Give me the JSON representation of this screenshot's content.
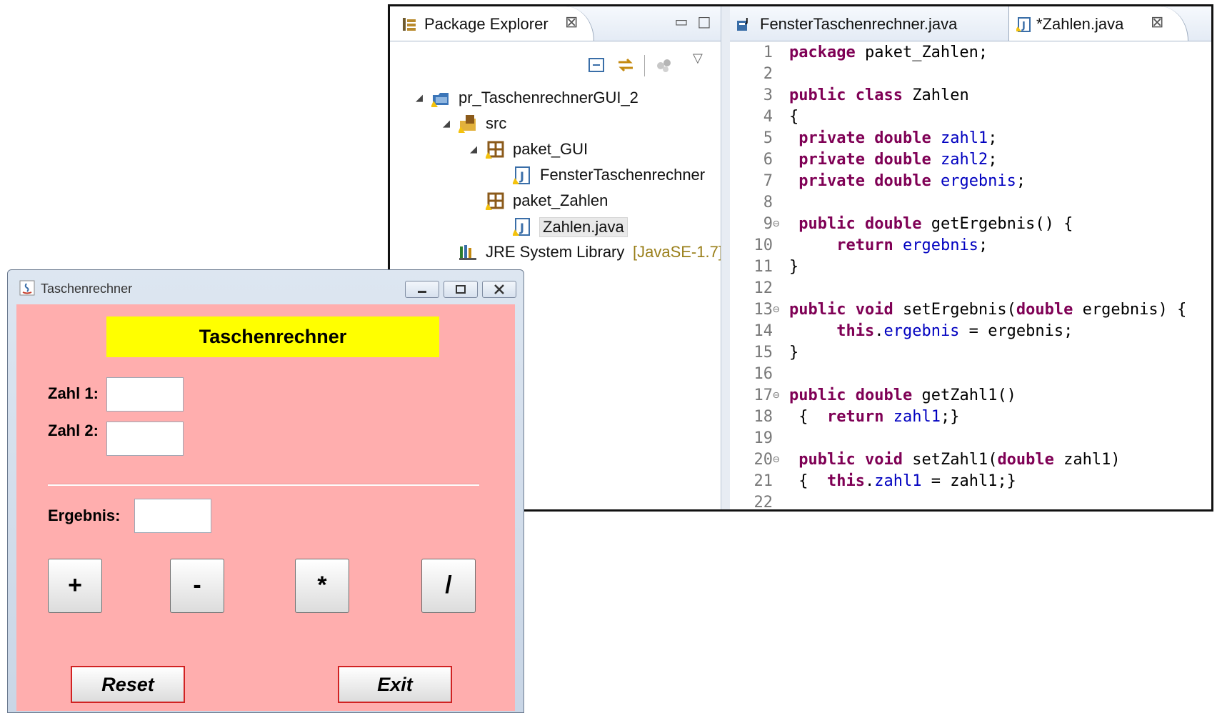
{
  "eclipse": {
    "package_explorer": {
      "tab_label": "Package Explorer",
      "tree": [
        {
          "label": "pr_TaschenrechnerGUI_2"
        },
        {
          "label": "src"
        },
        {
          "label": "paket_GUI"
        },
        {
          "label": "FensterTaschenrechner"
        },
        {
          "label": "paket_Zahlen"
        },
        {
          "label": "Zahlen.java"
        },
        {
          "label": "JRE System Library",
          "decoration": "[JavaSE-1.7]"
        }
      ]
    },
    "editor": {
      "tabs": [
        {
          "label": "FensterTaschenrechner.java"
        },
        {
          "label": "*Zahlen.java"
        }
      ],
      "lines": [
        {
          "n": "1",
          "code": "package paket_Zahlen;"
        },
        {
          "n": "2",
          "code": ""
        },
        {
          "n": "3",
          "code": "public class Zahlen"
        },
        {
          "n": "4",
          "code": "{"
        },
        {
          "n": "5",
          "code": " private double zahl1;"
        },
        {
          "n": "6",
          "code": " private double zahl2;"
        },
        {
          "n": "7",
          "code": " private double ergebnis;"
        },
        {
          "n": "8",
          "code": ""
        },
        {
          "n": "9",
          "code": " public double getErgebnis() {"
        },
        {
          "n": "10",
          "code": "     return ergebnis;"
        },
        {
          "n": "11",
          "code": "}"
        },
        {
          "n": "12",
          "code": ""
        },
        {
          "n": "13",
          "code": "public void setErgebnis(double ergebnis) {"
        },
        {
          "n": "14",
          "code": "     this.ergebnis = ergebnis;"
        },
        {
          "n": "15",
          "code": "}"
        },
        {
          "n": "16",
          "code": ""
        },
        {
          "n": "17",
          "code": "public double getZahl1()"
        },
        {
          "n": "18",
          "code": " {  return zahl1;}"
        },
        {
          "n": "19",
          "code": ""
        },
        {
          "n": "20",
          "code": " public void setZahl1(double zahl1)"
        },
        {
          "n": "21",
          "code": " {  this.zahl1 = zahl1;}"
        },
        {
          "n": "22",
          "code": ""
        }
      ]
    }
  },
  "calculator": {
    "window_title": "Taschenrechner",
    "header": "Taschenrechner",
    "label_zahl1": "Zahl 1:",
    "label_zahl2": "Zahl 2:",
    "label_ergebnis": "Ergebnis:",
    "value_zahl1": "",
    "value_zahl2": "",
    "value_ergebnis": "",
    "op_add": "+",
    "op_sub": "-",
    "op_mul": "*",
    "op_div": "/",
    "reset": "Reset",
    "exit": "Exit"
  },
  "colors": {
    "calc_background": "#ffaeae",
    "calc_header": "#ffff00",
    "java_keyword": "#7f0055",
    "java_field": "#0000c0"
  }
}
